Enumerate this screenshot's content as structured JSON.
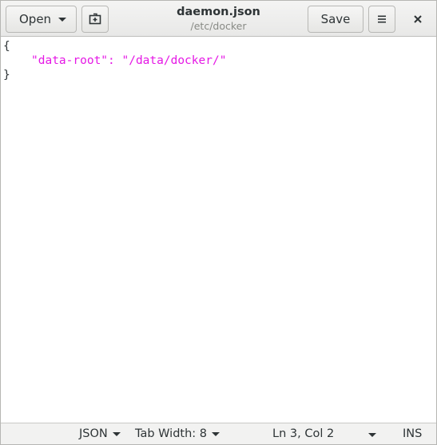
{
  "header": {
    "open_label": "Open",
    "title": "daemon.json",
    "subtitle": "/etc/docker",
    "save_label": "Save"
  },
  "editor": {
    "lines": [
      "{",
      "\"data-root\": \"/data/docker/\"",
      "}"
    ]
  },
  "statusbar": {
    "language": "JSON",
    "tab_width": "Tab Width: 8",
    "position": "Ln 3, Col 2",
    "mode": "INS"
  },
  "colors": {
    "string": "#e518e5",
    "text": "#2e3436",
    "subtitle": "#888a85"
  },
  "icons": {
    "new_document": "new-document-icon",
    "menu": "hamburger-menu-icon",
    "close": "close-icon"
  }
}
